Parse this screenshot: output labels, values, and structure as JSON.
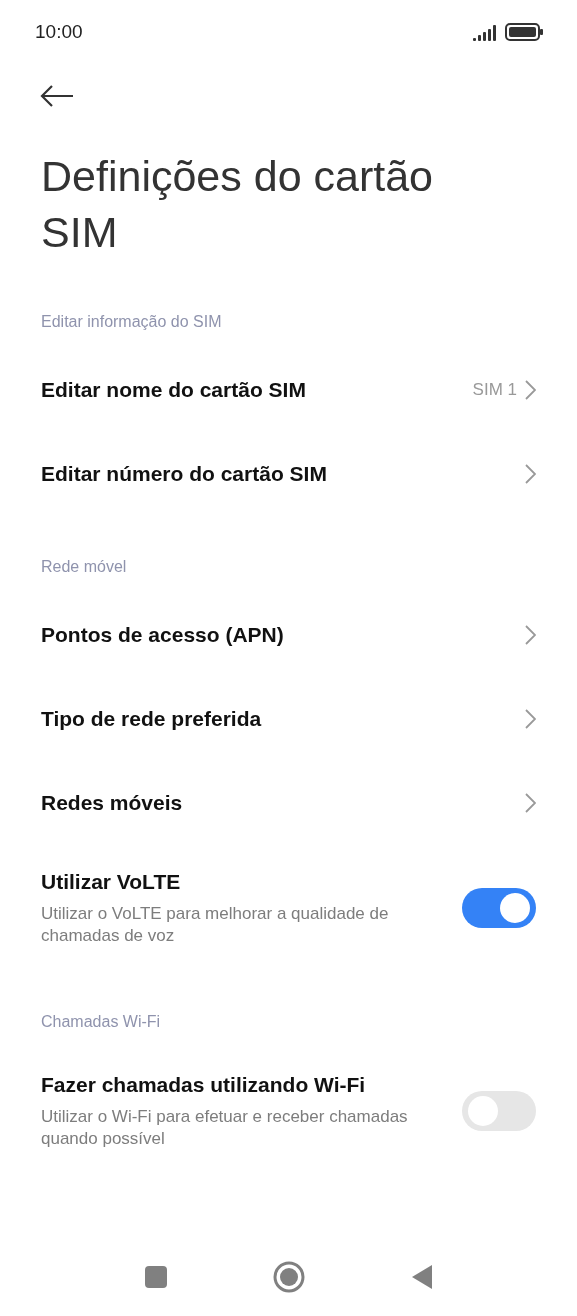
{
  "status_bar": {
    "time": "10:00"
  },
  "title": "Definições do cartão SIM",
  "sections": [
    {
      "header": "Editar informação do SIM",
      "items": [
        {
          "kind": "nav",
          "title": "Editar nome do cartão SIM",
          "value": "SIM 1"
        },
        {
          "kind": "nav",
          "title": "Editar número do cartão SIM"
        }
      ]
    },
    {
      "header": "Rede móvel",
      "items": [
        {
          "kind": "nav",
          "title": "Pontos de acesso (APN)"
        },
        {
          "kind": "nav",
          "title": "Tipo de rede preferida"
        },
        {
          "kind": "nav",
          "title": "Redes móveis"
        },
        {
          "kind": "toggle",
          "title": "Utilizar VoLTE",
          "subtitle": "Utilizar o VoLTE para melhorar a qualidade de chamadas de voz",
          "on": true
        }
      ]
    },
    {
      "header": "Chamadas Wi-Fi",
      "items": [
        {
          "kind": "toggle",
          "title": "Fazer chamadas utilizando Wi-Fi",
          "subtitle": "Utilizar o Wi-Fi para efetuar e receber chamadas quando possível",
          "on": false
        }
      ]
    }
  ]
}
